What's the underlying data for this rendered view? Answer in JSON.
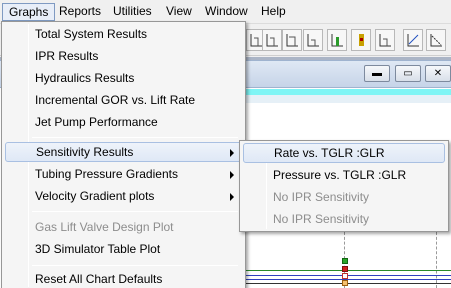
{
  "menubar": {
    "items": [
      {
        "label": "Graphs"
      },
      {
        "label": "Reports"
      },
      {
        "label": "Utilities"
      },
      {
        "label": "View"
      },
      {
        "label": "Window"
      },
      {
        "label": "Help"
      }
    ]
  },
  "graphs_menu": {
    "items": [
      {
        "label": "Total System Results"
      },
      {
        "label": "IPR Results"
      },
      {
        "label": "Hydraulics Results"
      },
      {
        "label": "Incremental GOR vs. Lift Rate"
      },
      {
        "label": "Jet Pump Performance"
      },
      {
        "label": "Sensitivity Results"
      },
      {
        "label": "Tubing Pressure Gradients"
      },
      {
        "label": "Velocity Gradient plots"
      },
      {
        "label": "Gas Lift Valve Design Plot"
      },
      {
        "label": "3D Simulator Table Plot"
      },
      {
        "label": "Reset All Chart Defaults"
      }
    ]
  },
  "sensitivity_submenu": {
    "items": [
      {
        "label": "Rate vs. TGLR :GLR"
      },
      {
        "label": "Pressure vs. TGLR :GLR"
      },
      {
        "label": "No IPR Sensitivity"
      },
      {
        "label": "No IPR Sensitivity"
      }
    ]
  },
  "window_controls": {
    "minimize": "▬",
    "restore": "▭",
    "close": "✕"
  },
  "colors": {
    "menu_highlight_border": "#a9c0e2",
    "active_menubar_border": "#7f9ac2",
    "mdi_background": "#abb5c6",
    "plot_cyan": "#7ff5f5"
  }
}
